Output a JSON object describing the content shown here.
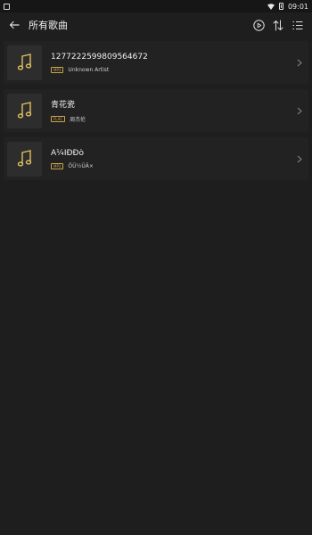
{
  "status": {
    "time": "09:01"
  },
  "header": {
    "title": "所有歌曲"
  },
  "songs": [
    {
      "title": "1277222599809564672",
      "format": "MP3",
      "artist": "Unknown Artist"
    },
    {
      "title": "青花瓷",
      "format": "FLAC",
      "artist": "周杰伦"
    },
    {
      "title": "À¼ÍÐÐò",
      "format": "MP3",
      "artist": "ÖÜ½ÜÂ×"
    }
  ],
  "colors": {
    "background": "#1e1e1e",
    "card": "#222222",
    "accent": "#caa54a"
  },
  "icons": {
    "back": "arrow-left-icon",
    "play_all": "play-circle-icon",
    "sort": "sort-icon",
    "menu": "list-menu-icon",
    "cover": "music-note-icon",
    "chevron": "chevron-right-icon"
  }
}
